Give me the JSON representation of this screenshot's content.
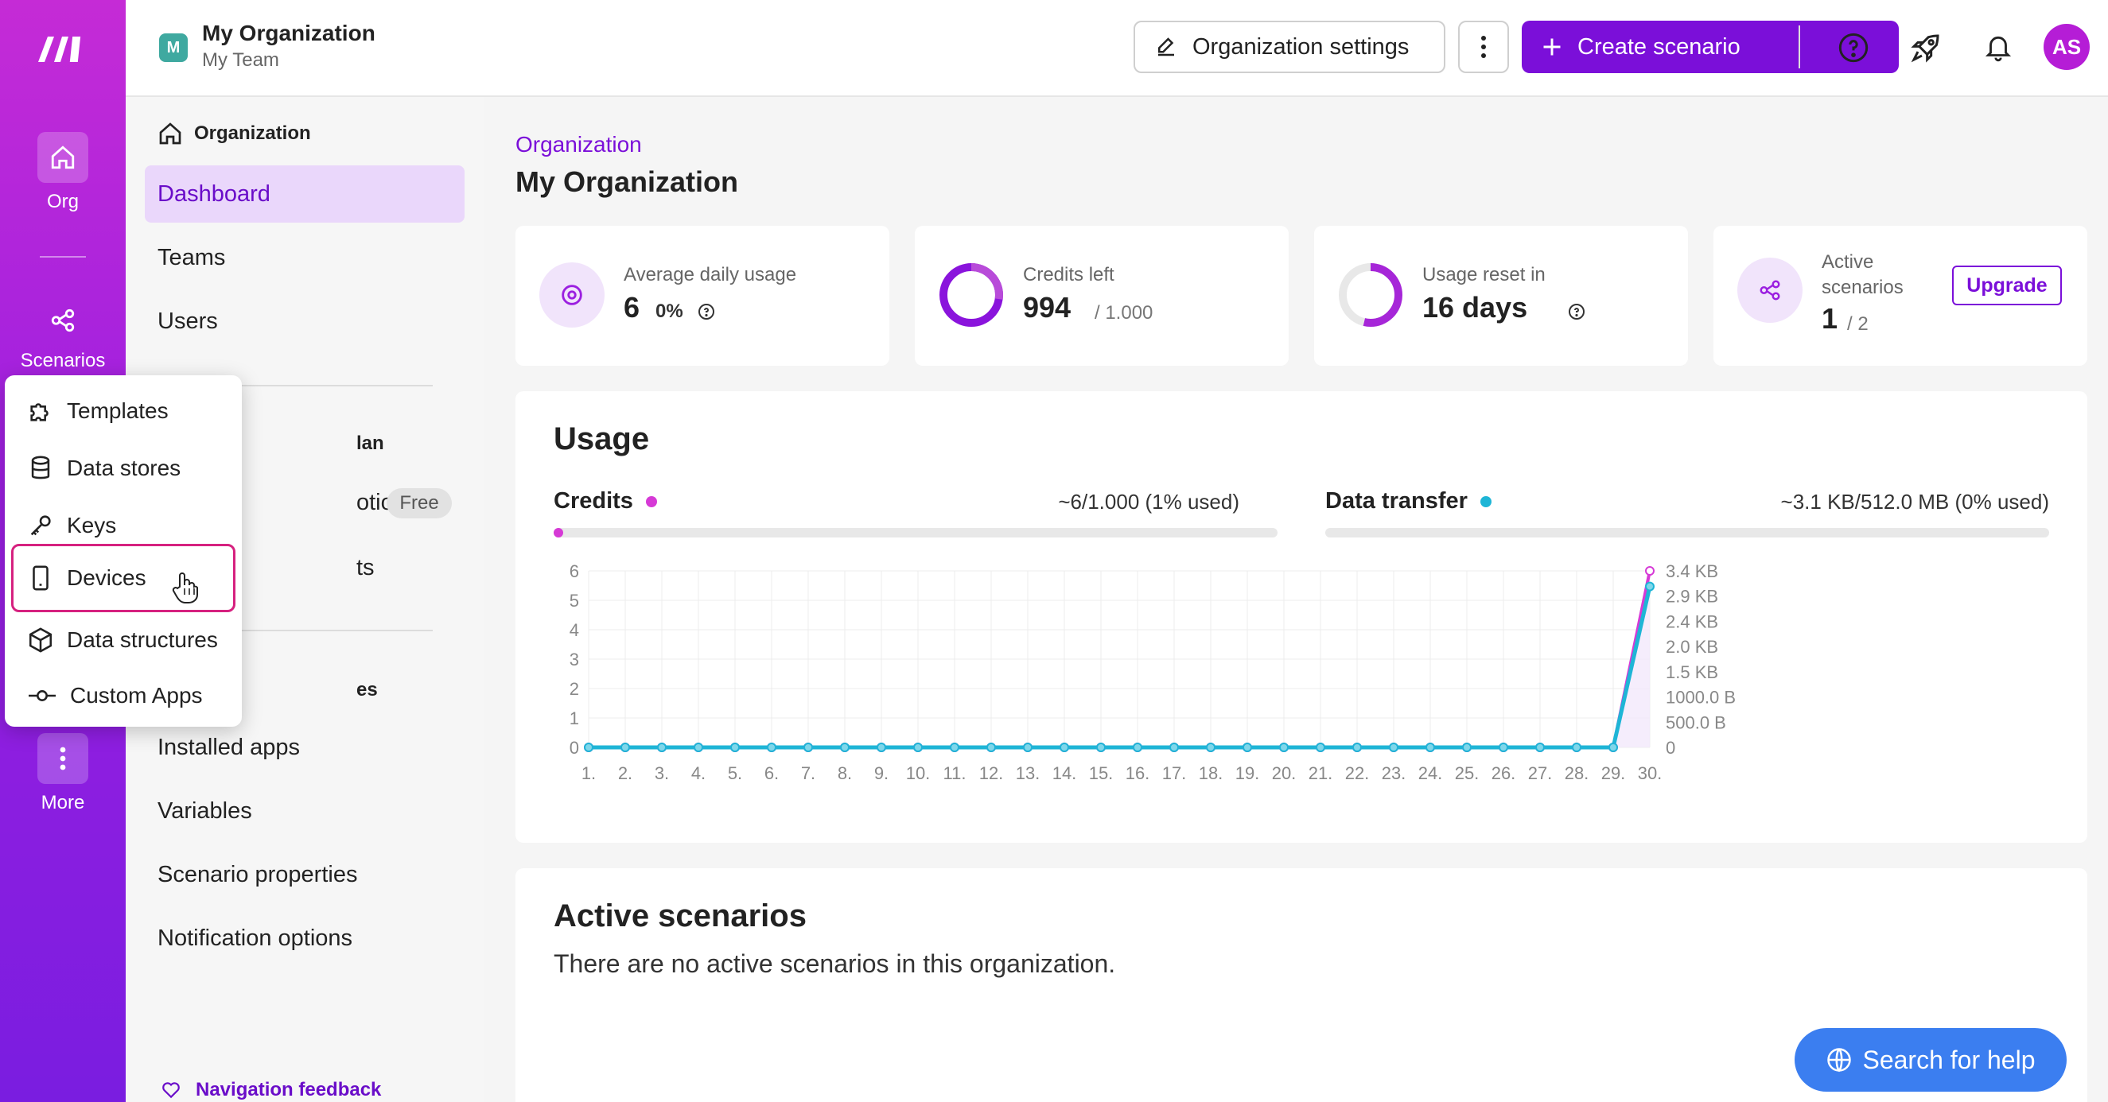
{
  "rail": {
    "org_label": "Org",
    "scenarios_label": "Scenarios",
    "more_label": "More"
  },
  "topbar": {
    "org_badge": "M",
    "org_name": "My Organization",
    "team_name": "My Team",
    "org_settings_label": "Organization settings",
    "create_label": "Create scenario",
    "avatar": "AS"
  },
  "sidebar": {
    "heading": "Organization",
    "items": [
      "Dashboard",
      "Teams",
      "Users"
    ],
    "section_plan": "lan",
    "subscription_frag": "otion",
    "free_badge": "Free",
    "payments_frag": "ts",
    "section_extra": "es",
    "lower_items": [
      "Installed apps",
      "Variables",
      "Scenario properties",
      "Notification options"
    ],
    "feedback": "Navigation feedback"
  },
  "popup": {
    "items": [
      {
        "label": "Templates",
        "icon": "puzzle-icon"
      },
      {
        "label": "Data stores",
        "icon": "database-icon"
      },
      {
        "label": "Keys",
        "icon": "key-icon"
      },
      {
        "label": "Devices",
        "icon": "mobile-device-icon"
      },
      {
        "label": "Data structures",
        "icon": "cube-icon"
      },
      {
        "label": "Custom Apps",
        "icon": "custom-app-icon"
      }
    ]
  },
  "main": {
    "breadcrumb": "Organization",
    "title": "My Organization",
    "stats": {
      "avg_label": "Average daily usage",
      "avg_value": "6",
      "avg_pct": "0%",
      "credits_label": "Credits left",
      "credits_value": "994",
      "credits_total": "/ 1.000",
      "reset_label": "Usage reset in",
      "reset_value": "16 days",
      "active_label_1": "Active",
      "active_label_2": "scenarios",
      "active_value": "1",
      "active_total": "/ 2",
      "upgrade": "Upgrade"
    },
    "usage": {
      "title": "Usage",
      "credits_name": "Credits",
      "credits_text": "~6/1.000 (1% used)",
      "credits_fraction": 0.01,
      "transfer_name": "Data transfer",
      "transfer_text": "~3.1 KB/512.0 MB (0% used)",
      "transfer_fraction": 0.0
    },
    "active": {
      "title": "Active scenarios",
      "empty": "There are no active scenarios in this organization."
    }
  },
  "help": "Search for help",
  "colors": {
    "brand": "#7b0fd9",
    "credits": "#d63ad6",
    "transfer": "#1eb5d6"
  },
  "chart_data": {
    "type": "line",
    "x": [
      "1.",
      "2.",
      "3.",
      "4.",
      "5.",
      "6.",
      "7.",
      "8.",
      "9.",
      "10.",
      "11.",
      "12.",
      "13.",
      "14.",
      "15.",
      "16.",
      "17.",
      "18.",
      "19.",
      "20.",
      "21.",
      "22.",
      "23.",
      "24.",
      "25.",
      "26.",
      "27.",
      "28.",
      "29.",
      "30."
    ],
    "left_ticks": [
      "0",
      "1",
      "2",
      "3",
      "4",
      "5",
      "6"
    ],
    "right_ticks": [
      "0",
      "500.0 B",
      "1000.0 B",
      "1.5 KB",
      "2.0 KB",
      "2.4 KB",
      "2.9 KB",
      "3.4 KB"
    ],
    "ylim": [
      0,
      6
    ],
    "series": [
      {
        "name": "Credits",
        "values": [
          0,
          0,
          0,
          0,
          0,
          0,
          0,
          0,
          0,
          0,
          0,
          0,
          0,
          0,
          0,
          0,
          0,
          0,
          0,
          0,
          0,
          0,
          0,
          0,
          0,
          0,
          0,
          0,
          0,
          6
        ]
      },
      {
        "name": "Data transfer",
        "values": [
          0,
          0,
          0,
          0,
          0,
          0,
          0,
          0,
          0,
          0,
          0,
          0,
          0,
          0,
          0,
          0,
          0,
          0,
          0,
          0,
          0,
          0,
          0,
          0,
          0,
          0,
          0,
          0,
          0,
          3.1
        ]
      }
    ],
    "right_unit_max_kb": 3.4,
    "grid": true
  }
}
